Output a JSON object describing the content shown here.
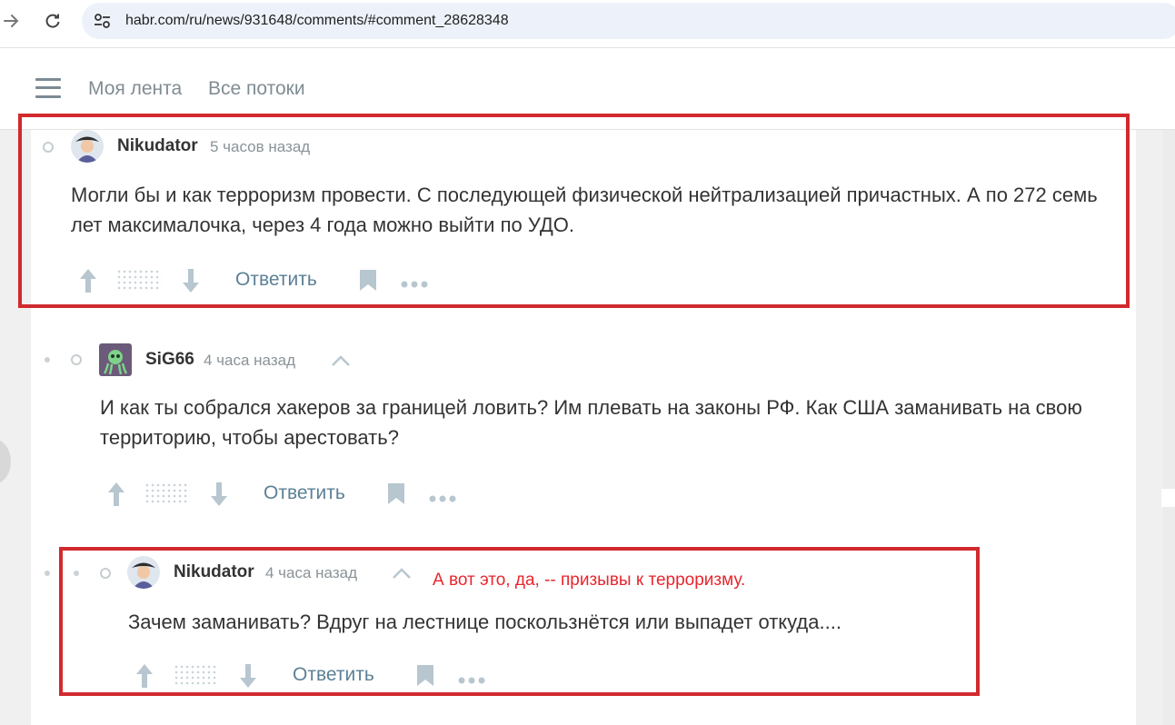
{
  "browser": {
    "url": "habr.com/ru/news/931648/comments/#comment_28628348"
  },
  "header": {
    "nav": [
      "Моя лента",
      "Все потоки"
    ]
  },
  "comments": [
    {
      "author": "Nikudator",
      "time": "5 часов назад",
      "text": "Могли бы и как терроризм провести. С последующей физической нейтрализацией причастных. А по 272 семь лет максималочка, через 4 года можно выйти по УДО.",
      "reply_label": "Ответить"
    },
    {
      "author": "SiG66",
      "time": "4 часа назад",
      "text": "И как ты собрался хакеров за границей ловить? Им плевать на законы РФ. Как США заманивать на свою территорию, чтобы арестовать?",
      "reply_label": "Ответить"
    },
    {
      "author": "Nikudator",
      "time": "4 часа назад",
      "text": "Зачем заманивать? Вдруг на лестнице поскользнётся или выпадет откуда....",
      "reply_label": "Ответить"
    }
  ],
  "annotation": "А вот это, да, -- призывы к терроризму.",
  "colors": {
    "highlight": "#d12a2e",
    "annotation": "#e8262e",
    "reply_link": "#5c8096"
  }
}
